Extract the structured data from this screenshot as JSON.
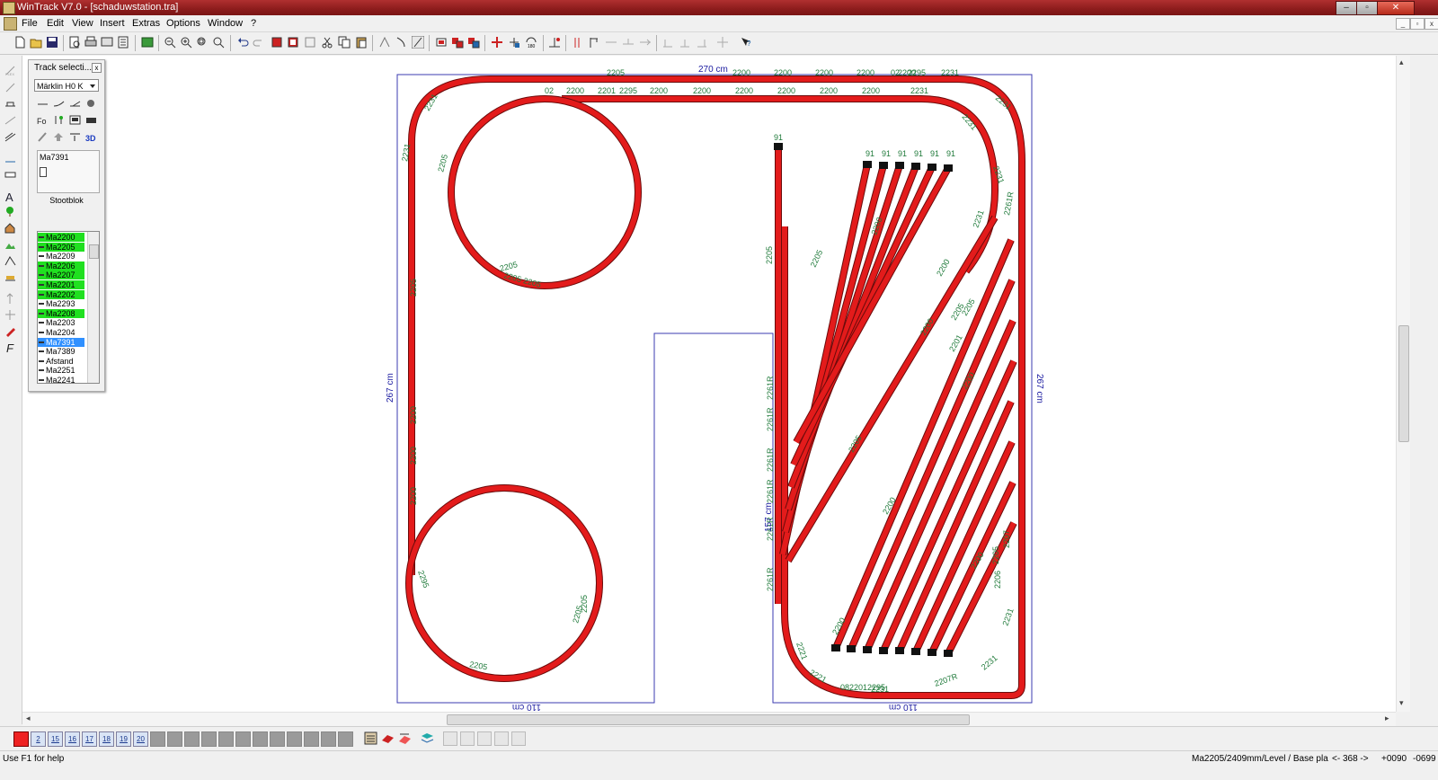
{
  "window": {
    "title": "WinTrack  V7.0 - [schaduwstation.tra]"
  },
  "menu": [
    "File",
    "Edit",
    "View",
    "Insert",
    "Extras",
    "Options",
    "Window",
    "?"
  ],
  "palette": {
    "title": "Track selecti...",
    "manufacturer": "Märklin H0 K",
    "selected_part": "Ma7391",
    "part_description": "Stootblok",
    "parts": [
      {
        "label": "Ma2200",
        "state": "green"
      },
      {
        "label": "Ma2205",
        "state": "green"
      },
      {
        "label": "Ma2209",
        "state": "none"
      },
      {
        "label": "Ma2206",
        "state": "green"
      },
      {
        "label": "Ma2207",
        "state": "green"
      },
      {
        "label": "Ma2201",
        "state": "green"
      },
      {
        "label": "Ma2202",
        "state": "green"
      },
      {
        "label": "Ma2293",
        "state": "none"
      },
      {
        "label": "Ma2208",
        "state": "green"
      },
      {
        "label": "Ma2203",
        "state": "none"
      },
      {
        "label": "Ma2204",
        "state": "none"
      },
      {
        "label": "Ma7391",
        "state": "selected"
      },
      {
        "label": "Ma7389",
        "state": "none"
      },
      {
        "label": "Afstand",
        "state": "none"
      },
      {
        "label": "Ma2251",
        "state": "none"
      },
      {
        "label": "Ma2241",
        "state": "none"
      }
    ]
  },
  "drawing": {
    "colors": {
      "track": "#e31b1b",
      "track_edge": "#6a0b0b",
      "label": "#1f7a3a",
      "dimension": "#1a1aa0",
      "outline": "#3b3bb0"
    },
    "dimensions": {
      "top": "270 cm",
      "left": "267 cm",
      "right": "267 cm",
      "middle": "157 cm",
      "bottom_left": "110 cm",
      "bottom_right": "110 cm"
    },
    "labels": {
      "top_row": [
        "2205",
        "2200",
        "2200",
        "2200",
        "2200",
        "2200",
        "02",
        "2295",
        "2231"
      ],
      "second_row": [
        "02",
        "2200",
        "2201",
        "2295",
        "2200",
        "2200",
        "2200",
        "2200",
        "2200",
        "2200",
        "2231"
      ],
      "left_side": [
        "2231",
        "2231",
        "2205",
        "2205",
        "2200",
        "2200",
        "2200",
        "2295"
      ],
      "small_circle": [
        "2205",
        "2205 2205"
      ],
      "big_circle": [
        "2205",
        "2205",
        "2205"
      ],
      "right_curve": [
        "2231",
        "2231",
        "2231",
        "2261R",
        "2231",
        "2205",
        "2207",
        "2206",
        "2231",
        "2231"
      ],
      "bottom": [
        "2221",
        "0822012295",
        "2231",
        "2207R",
        "2221",
        "2200"
      ],
      "buffers": [
        "91",
        "91",
        "91",
        "91",
        "91",
        "91",
        "91"
      ],
      "middle": [
        "2205",
        "2261R",
        "2261R",
        "2261R",
        "2261R",
        "2261R",
        "2261R"
      ],
      "yard": [
        "2205",
        "2200",
        "2200",
        "2200",
        "2205",
        "2205",
        "2205",
        "2201",
        "2200",
        "2200",
        "2200"
      ]
    }
  },
  "layers": {
    "buttons": [
      "2",
      "15",
      "16",
      "17",
      "18",
      "19",
      "20"
    ]
  },
  "status": {
    "help": "Use F1 for help",
    "part": "Ma2205/2409mm/Level / Base pla",
    "nav": "<- 368 ->",
    "x": "+0090",
    "y": "-0699"
  }
}
